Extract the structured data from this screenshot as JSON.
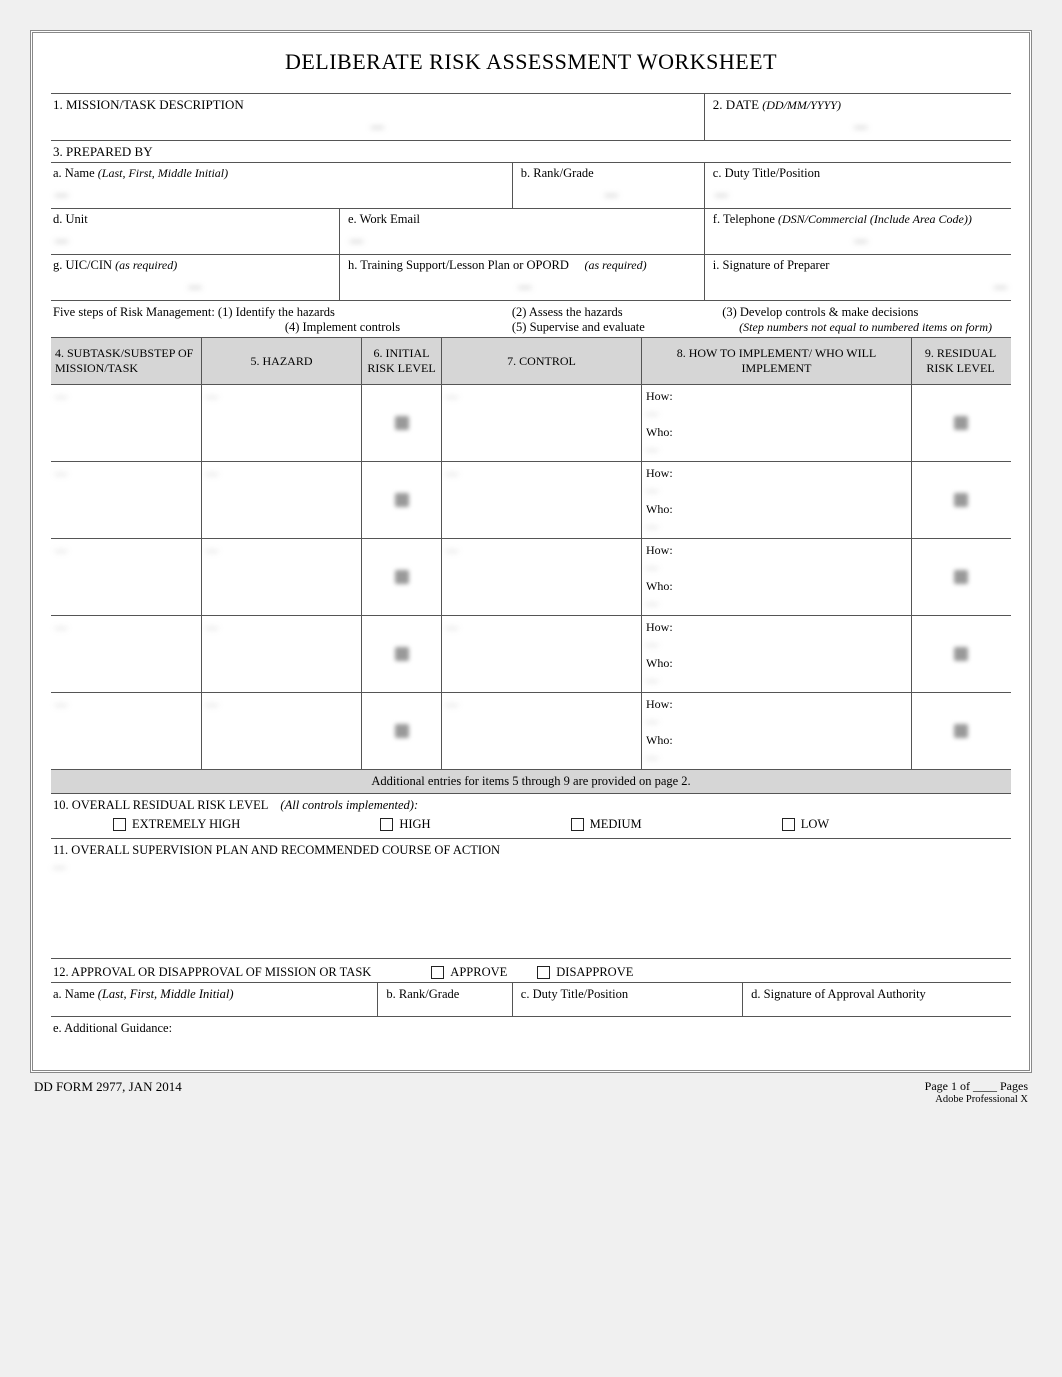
{
  "title": "DELIBERATE RISK ASSESSMENT WORKSHEET",
  "block1": {
    "label": "1.   MISSION/TASK DESCRIPTION",
    "value": "—"
  },
  "block2": {
    "label": "2.   DATE",
    "hint": "(DD/MM/YYYY)",
    "value": "—"
  },
  "block3": {
    "label": "3.   PREPARED BY",
    "a_label": "a.   Name",
    "a_hint": "(Last, First, Middle Initial)",
    "a_value": "—",
    "b_label": "b. Rank/Grade",
    "b_value": "—",
    "c_label": "c. Duty Title/Position",
    "c_value": "—",
    "d_label": "d. Unit",
    "d_value": "—",
    "e_label": "e. Work Email",
    "e_value": "—",
    "f_label": "f. Telephone",
    "f_hint": "(DSN/Commercial (Include Area Code))",
    "f_value": "—",
    "g_label": "g. UIC/CIN",
    "g_hint": "(as required)",
    "g_value": "—",
    "h_label": "h.   Training Support/Lesson Plan or OPORD",
    "h_hint": "(as required)",
    "h_value": "—",
    "i_label": "i.  Signature of Preparer",
    "i_value": "—"
  },
  "steps": {
    "intro": "Five steps of Risk Management: (1) Identify the hazards",
    "s2": "(2) Assess the hazards",
    "s3": "(3) Develop controls & make decisions",
    "s4": "(4) Implement controls",
    "s5": "(5) Supervise and evaluate",
    "note": "(Step numbers not equal to numbered items on form)"
  },
  "riskHeaders": {
    "c4": "4.  SUBTASK/SUBSTEP OF MISSION/TASK",
    "c5": "5.  HAZARD",
    "c6": "6.  INITIAL RISK LEVEL",
    "c7": "7.  CONTROL",
    "c8": "8.  HOW TO IMPLEMENT/ WHO WILL IMPLEMENT",
    "c9": "9.  RESIDUAL RISK LEVEL"
  },
  "howLabel": "How:",
  "whoLabel": "Who:",
  "riskRows": [
    {
      "subtask": "—",
      "hazard": "—",
      "control": "—",
      "how": "—",
      "who": "—"
    },
    {
      "subtask": "—",
      "hazard": "—",
      "control": "—",
      "how": "—",
      "who": "—"
    },
    {
      "subtask": "—",
      "hazard": "—",
      "control": "—",
      "how": "—",
      "who": "—"
    },
    {
      "subtask": "—",
      "hazard": "—",
      "control": "—",
      "how": "—",
      "who": "—"
    },
    {
      "subtask": "—",
      "hazard": "—",
      "control": "—",
      "how": "—",
      "who": "—"
    }
  ],
  "addlEntries": "Additional entries for items 5 through 9 are provided on page 2.",
  "block10": {
    "label": "10.   OVERALL RESIDUAL RISK LEVEL",
    "hint": "(All controls implemented):",
    "choices": [
      "EXTREMELY HIGH",
      "HIGH",
      "MEDIUM",
      "LOW"
    ]
  },
  "block11": {
    "label": "11.   OVERALL SUPERVISION PLAN     AND RECOMMENDED COURSE OF ACTION",
    "value": "—"
  },
  "block12": {
    "label": "12.    APPROVAL OR DISAPPROVAL OF MISSION OR TASK",
    "approve": "APPROVE",
    "disapprove": "DISAPPROVE",
    "a_label": "a.   Name",
    "a_hint": "(Last, First, Middle Initial)",
    "b_label": "b.    Rank/Grade",
    "c_label": "c.   Duty Title/Position",
    "d_label": "d.   Signature of Approval Authority",
    "e_label": "e.   Additional Guidance:"
  },
  "footer": {
    "left": "DD FORM 2977, JAN 2014",
    "right1": "Page 1 of ____ Pages",
    "right2": "Adobe Professional X"
  }
}
